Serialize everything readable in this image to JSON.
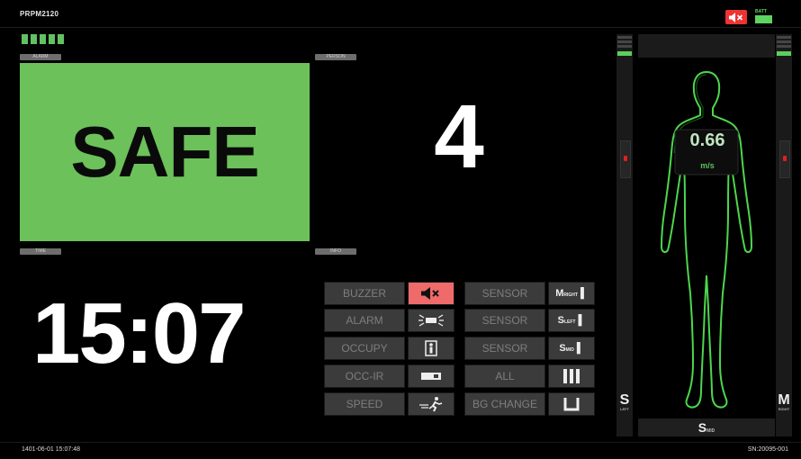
{
  "header": {
    "device_name": "PRPM2120",
    "mute_icon": "speaker-muted-icon",
    "battery_label": "BATT"
  },
  "panels": {
    "status": {
      "tag": "ALARM",
      "value": "SAFE",
      "color": "#6cc15a"
    },
    "count": {
      "tag": "PERSON",
      "value": "4"
    },
    "time": {
      "tag": "TIME",
      "value": "15:07"
    },
    "secondary_tag": "INFO"
  },
  "buttons": {
    "rows": [
      {
        "label": "BUZZER",
        "icon": "speaker-muted-icon",
        "active": true,
        "sensor_label": "SENSOR",
        "sensor_icon": "M"
      },
      {
        "label": "ALARM",
        "icon": "alarm-light-icon",
        "active": false,
        "sensor_label": "SENSOR",
        "sensor_icon": "S"
      },
      {
        "label": "OCCUPY",
        "icon": "person-box-icon",
        "active": false,
        "sensor_label": "SENSOR",
        "sensor_icon": "S"
      },
      {
        "label": "OCC-IR",
        "icon": "ir-sensor-icon",
        "active": false,
        "sensor_label": "ALL",
        "sensor_icon": "bars-icon"
      },
      {
        "label": "SPEED",
        "icon": "running-person-icon",
        "active": false,
        "sensor_label": "BG CHANGE",
        "sensor_icon": "bracket-icon"
      }
    ]
  },
  "body_panel": {
    "speed_value": "0.66",
    "speed_unit": "m/s",
    "left_letter": "S",
    "right_letter": "M",
    "bottom_letter": "S",
    "outline_color": "#4dd64d"
  },
  "footer": {
    "datetime": "1401-06-01 15:07:48",
    "serial": "SN:20095-001"
  }
}
